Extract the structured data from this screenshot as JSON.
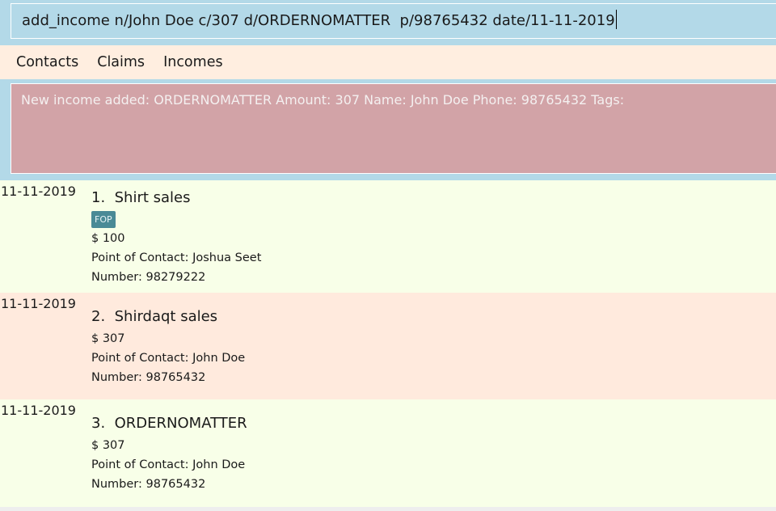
{
  "command": {
    "value": "add_income n/John Doe c/307 d/ORDERNOMATTER  p/98765432 date/11-11-2019"
  },
  "menu": {
    "contacts": "Contacts",
    "claims": "Claims",
    "incomes": "Incomes"
  },
  "result": {
    "message": "New income added: ORDERNOMATTER Amount: 307 Name: John Doe Phone: 98765432 Tags:"
  },
  "incomes": [
    {
      "date": "11-11-2019",
      "title": "1.  Shirt sales",
      "tag": "FOP",
      "amount": "$ 100",
      "contact": "Point of Contact: Joshua Seet",
      "number": "Number: 98279222"
    },
    {
      "date": "11-11-2019",
      "title": "2.  Shirdaqt sales",
      "amount": "$ 307",
      "contact": "Point of Contact: John Doe",
      "number": "Number: 98765432"
    },
    {
      "date": "11-11-2019",
      "title": "3.  ORDERNOMATTER",
      "amount": "$ 307",
      "contact": "Point of Contact: John Doe",
      "number": "Number: 98765432"
    }
  ],
  "colors": {
    "command_bg": "#b3d9e8",
    "menu_bg": "#ffeee0",
    "result_bg": "#d2a3a7",
    "card_odd_bg": "#f8ffe8",
    "card_even_bg": "#ffeadd",
    "tag_bg": "#4a8a96"
  }
}
